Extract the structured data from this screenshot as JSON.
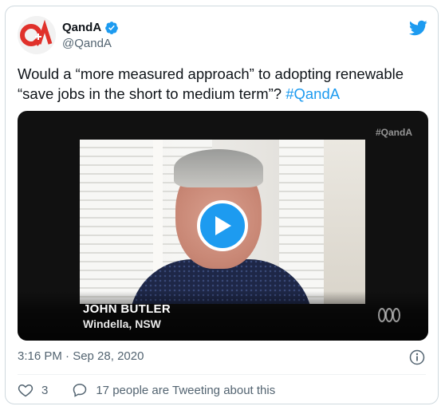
{
  "tweet": {
    "author": {
      "display_name": "QandA",
      "handle": "@QandA",
      "verified": true,
      "avatar_text": "Q+A"
    },
    "text_main": "Would a “more measured approach” to adopting renewable “save jobs in the short to medium term”? ",
    "hashtag": "#QandA",
    "media": {
      "watermark": "#QandA",
      "caption_name": "JOHN BUTLER",
      "caption_location": "Windella, NSW"
    },
    "timestamp": "3:16 PM · Sep 28, 2020",
    "like_count": "3",
    "conversation_label": "17 people are Tweeting about this"
  },
  "colors": {
    "accent": "#1d9bf0",
    "avatar_red": "#e0312b",
    "secondary_text": "#536471"
  },
  "icons": [
    "verified-badge-icon",
    "twitter-bird-icon",
    "play-icon",
    "abc-logo-icon",
    "info-icon",
    "heart-icon",
    "reply-bubble-icon"
  ]
}
